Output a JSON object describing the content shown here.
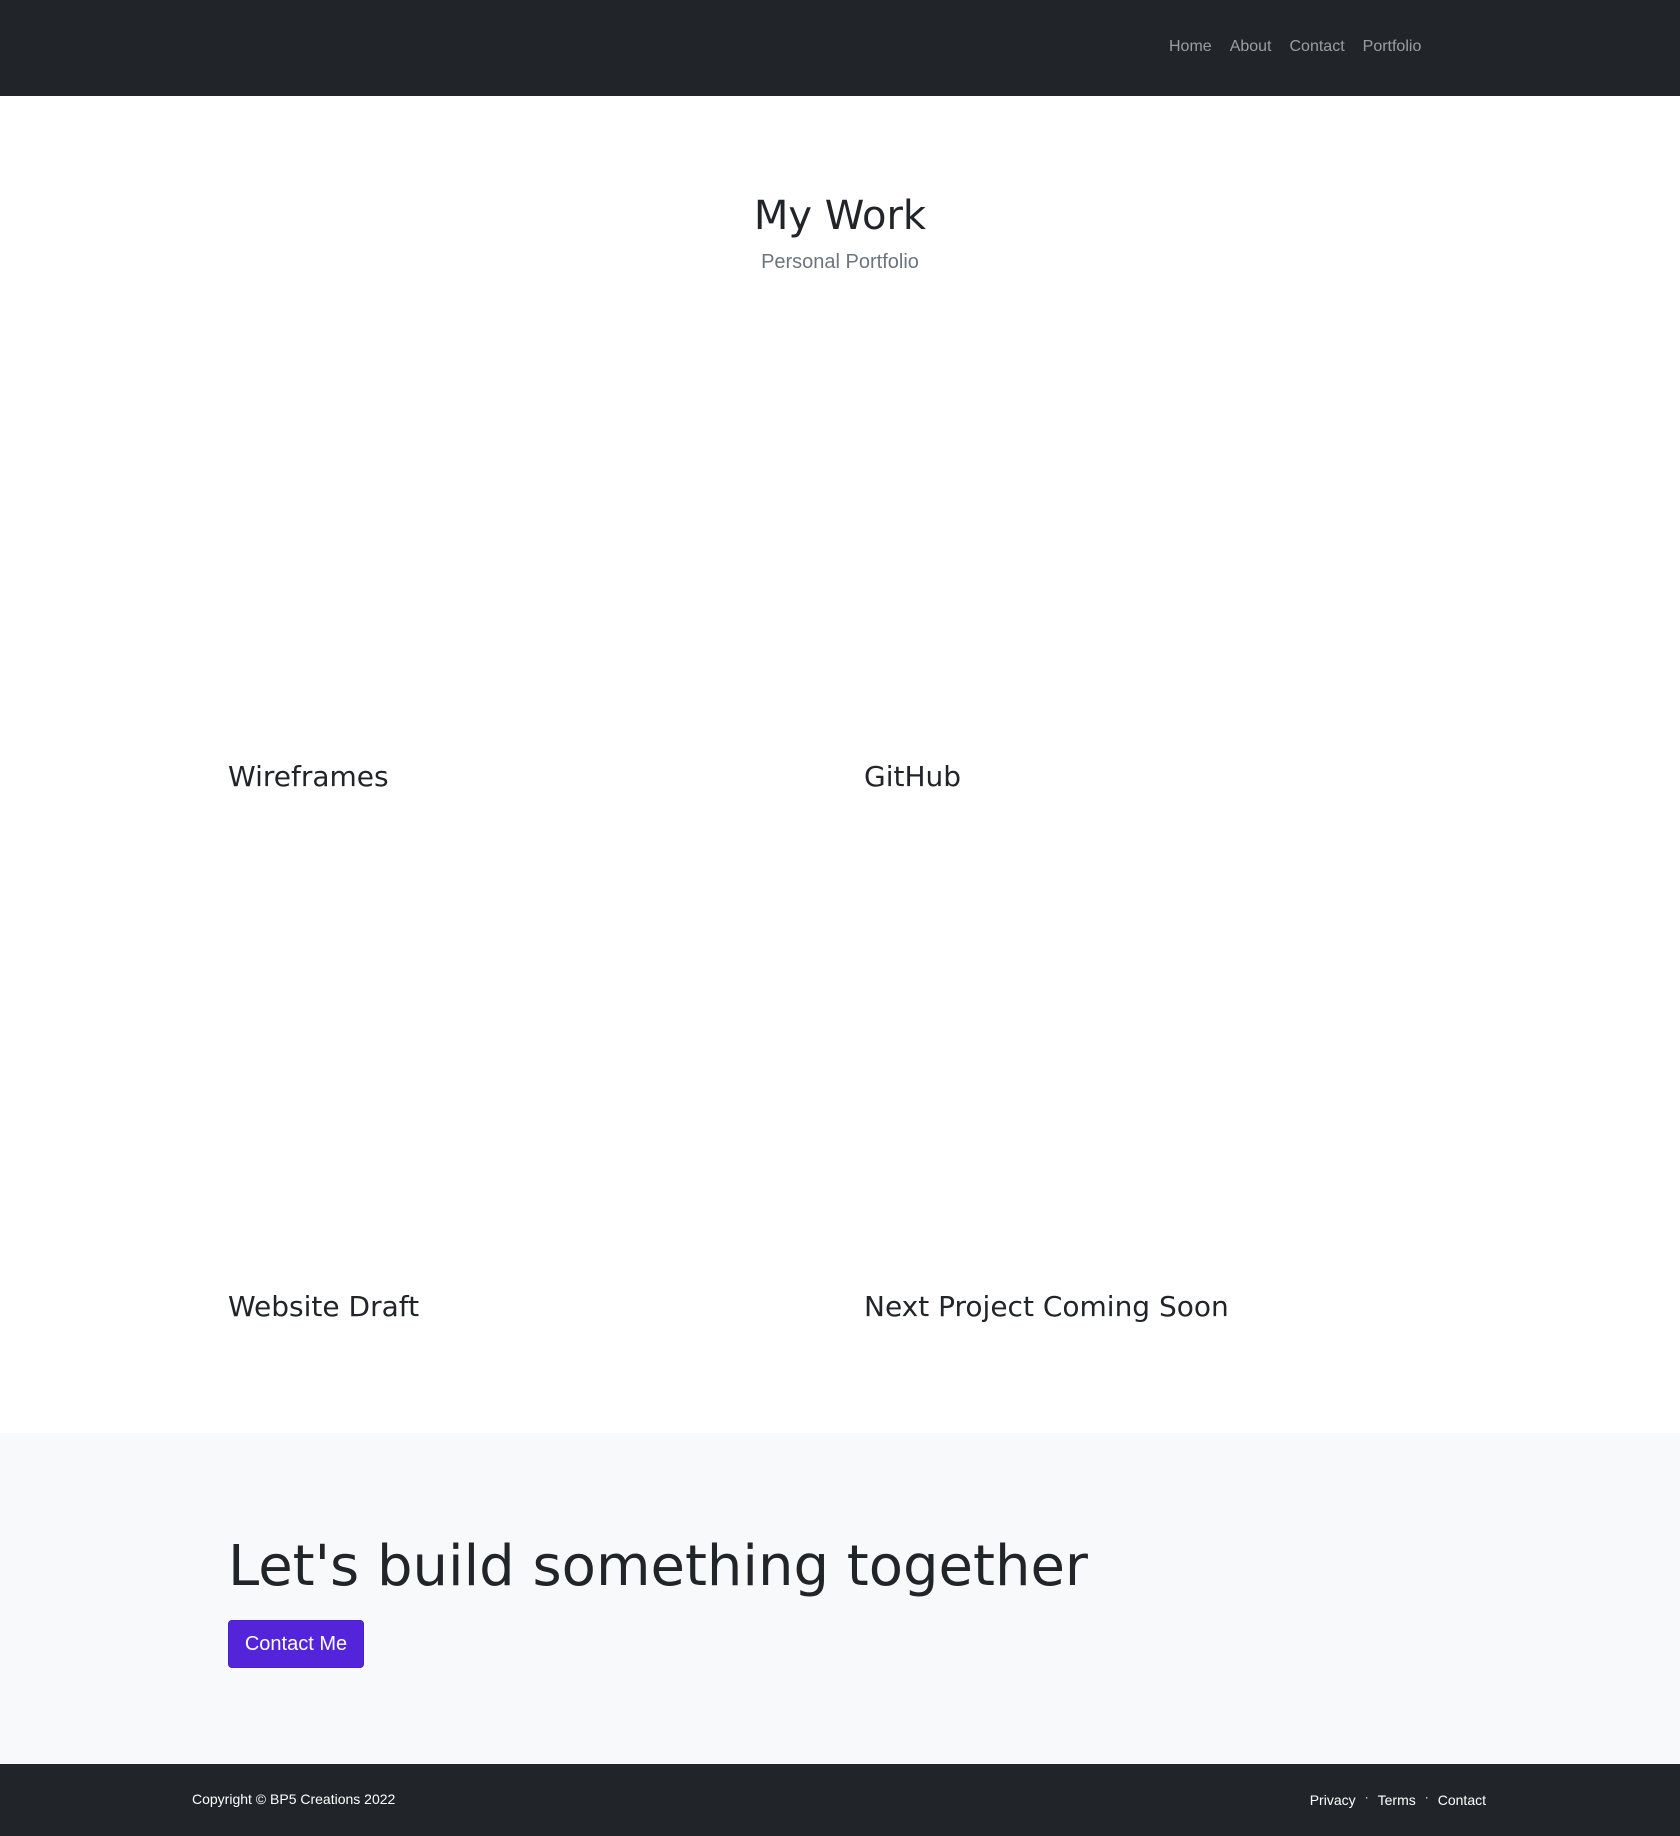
{
  "nav": {
    "links": [
      "Home",
      "About",
      "Contact",
      "Portfolio"
    ]
  },
  "header": {
    "title": "My Work",
    "subtitle": "Personal Portfolio"
  },
  "portfolio": {
    "items": [
      {
        "title": "Wireframes"
      },
      {
        "title": "GitHub"
      },
      {
        "title": "Website Draft"
      },
      {
        "title": "Next Project Coming Soon"
      }
    ]
  },
  "cta": {
    "heading": "Let's build something together",
    "button_label": "Contact Me",
    "button_color": "#5424db"
  },
  "footer": {
    "copyright": "Copyright © BP5 Creations 2022",
    "links": [
      "Privacy",
      "Terms",
      "Contact"
    ],
    "separator": "·"
  },
  "colors": {
    "navbar_bg": "#212529",
    "cta_bg": "#f8f9fa",
    "subtitle": "#6c757d"
  }
}
